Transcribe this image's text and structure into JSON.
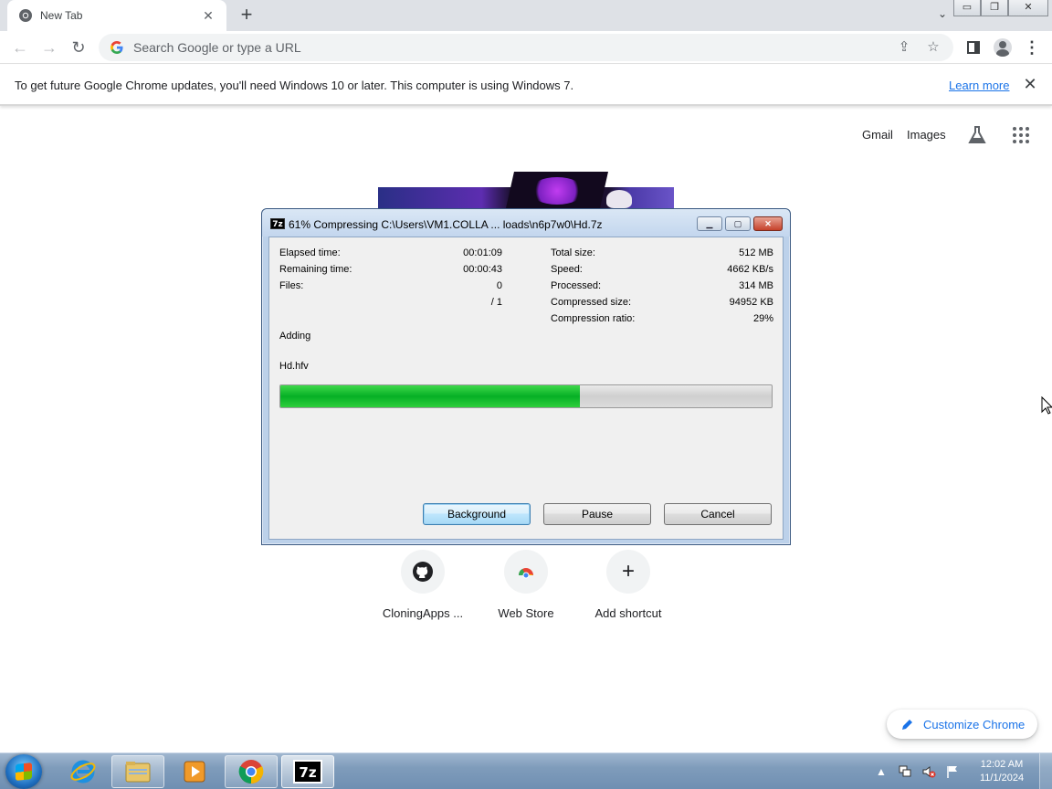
{
  "browser": {
    "tab": {
      "title": "New Tab",
      "icon": "chrome-icon"
    },
    "omnibox": {
      "placeholder": "Search Google or type a URL"
    },
    "infobar": {
      "message": "To get future Google Chrome updates, you'll need Windows 10 or later. This computer is using Windows 7.",
      "link": "Learn more"
    }
  },
  "ntp": {
    "header_links": [
      "Gmail",
      "Images"
    ],
    "shortcuts": [
      {
        "label": "CloningApps ...",
        "icon": "github-icon"
      },
      {
        "label": "Web Store",
        "icon": "web-store-icon"
      },
      {
        "label": "Add shortcut",
        "icon": "plus-icon",
        "glyph": "+"
      }
    ],
    "customize_label": "Customize Chrome"
  },
  "dialog": {
    "title": "61% Compressing C:\\Users\\VM1.COLLA ... loads\\n6p7w0\\Hd.7z",
    "app_icon_text": "7z",
    "left_stats": [
      {
        "label": "Elapsed time:",
        "value": "00:01:09"
      },
      {
        "label": "Remaining time:",
        "value": "00:00:43"
      },
      {
        "label": "Files:",
        "value": "0"
      },
      {
        "label": "",
        "value": "/ 1"
      }
    ],
    "right_stats": [
      {
        "label": "Total size:",
        "value": "512 MB"
      },
      {
        "label": "Speed:",
        "value": "4662 KB/s"
      },
      {
        "label": "Processed:",
        "value": "314 MB"
      },
      {
        "label": "Compressed size:",
        "value": "94952 KB"
      },
      {
        "label": "Compression ratio:",
        "value": "29%"
      }
    ],
    "status": "Adding",
    "current_file": "Hd.hfv",
    "progress_percent": 61,
    "buttons": {
      "background": "Background",
      "pause": "Pause",
      "cancel": "Cancel"
    }
  },
  "taskbar": {
    "clock_time": "12:02 AM",
    "clock_date": "11/1/2024",
    "apps": [
      "internet-explorer",
      "windows-explorer",
      "media-player",
      "chrome",
      "7-zip"
    ],
    "tray_7zip_text": "7z"
  },
  "colors": {
    "accent_blue": "#1a73e8",
    "progress_green": "#06b025",
    "dialog_frame": "#bcd1ea"
  }
}
